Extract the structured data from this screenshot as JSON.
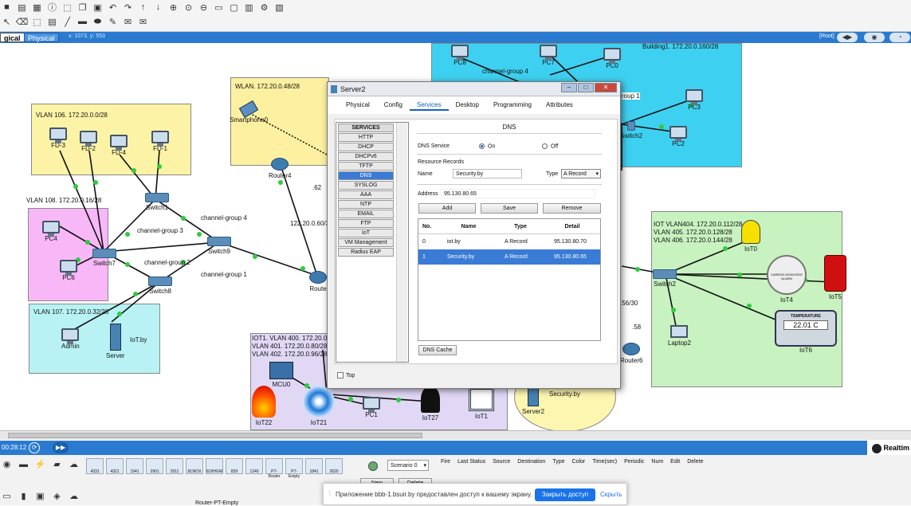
{
  "workspace_header": {
    "mode_logical": "gical",
    "mode_physical": "Physical",
    "coords": "x: 1073, y: 553",
    "root": "[Root]"
  },
  "areas": {
    "vlan106": "VLAN 106. 172.20.0.0/28",
    "vlan108": "VLAN 108. 172.20.0.16/28",
    "vlan107": "VLAN 107. 172.20.0.32/28",
    "wlan": "WLAN. 172.20.0.48/28",
    "building1": "Building1. 172.20.0.160/28",
    "iot_right": [
      "IOT VLAN404. 172.20.0.112/28",
      "VLAN 405. 172.20.0.128/28",
      "VLAN 406. 172.20.0.144/28"
    ],
    "iot_bottom": [
      "IOT1. VLAN 400. 172.20.0.64/28",
      "VLAN 401. 172.20.0.80/28",
      "VLAN 402. 172.20.0.96/28"
    ]
  },
  "devices": {
    "fd3": "FD-3",
    "fd2": "FD-2",
    "fd4": "FD-4",
    "fd1": "FD-1",
    "switch1": "Switch1",
    "switch9": "Switch9",
    "switch7": "Switch7",
    "switch8": "Switch8",
    "pc4": "PC4",
    "pc6": "PC6",
    "admin": "Admin",
    "server": "Server",
    "iotby": "IoT.by",
    "smartphone": "Smartphone0",
    "router4": "Router4",
    "router": "Route",
    "pc8": "PC8",
    "pc7": "PC7",
    "pc0": "PC0",
    "pc3": "PC3",
    "pc2": "PC2",
    "switch2": "Switch2",
    "switch2b": "Switch2",
    "iot0": "IoT0",
    "iot4": "IoT4",
    "iot5": "IoT5",
    "laptop2": "Laptop2",
    "iot6": "IoT6",
    "mcu0": "MCU0",
    "iot22": "IoT22",
    "iot21": "IoT21",
    "pc1": "PC1",
    "iot27": "IoT27",
    "iot1": "IoT1",
    "server2": "Server2",
    "security": "Security.by",
    "router6": "Router6"
  },
  "link_labels": {
    "cg4": "channel-group 4",
    "cg3": "channel-group 3",
    "cg2": "channel-group 2",
    "cg1": "channel-group 1",
    "cg4_top": "channel-group 4",
    "cg1_top": "roup 1",
    "ip62": ".62",
    "net60": "122.20.0.60/3",
    "ip5630": ".56/30",
    "ip58": ".58",
    "ip1": "1"
  },
  "iot_display": {
    "temperature_label": "TEMPERATURE",
    "temperature_value": "22.01 C",
    "alarm_text": "CARBON MONOXIDE ALARM"
  },
  "dialog": {
    "title": "Server2",
    "tabs": [
      "Physical",
      "Config",
      "Services",
      "Desktop",
      "Programming",
      "Attributes"
    ],
    "active_tab": "Services",
    "services": [
      "SERVICES",
      "HTTP",
      "DHCP",
      "DHCPv6",
      "TFTP",
      "DNS",
      "SYSLOG",
      "AAA",
      "NTP",
      "EMAIL",
      "FTP",
      "IoT",
      "VM Management",
      "Radius EAP"
    ],
    "selected_service": "DNS",
    "dns": {
      "title": "DNS",
      "service_label": "DNS Service",
      "on": "On",
      "off": "Off",
      "resource_records": "Resource Records",
      "name_label": "Name",
      "name_value": "Security.by",
      "type_label": "Type",
      "type_value": "A Record",
      "address_label": "Address",
      "address_value": "95.130.80.65",
      "add": "Add",
      "save": "Save",
      "remove": "Remove",
      "columns": [
        "No.",
        "Name",
        "Type",
        "Detail"
      ],
      "records": [
        {
          "no": "0",
          "name": "iot.by",
          "type": "A Record",
          "detail": "95.130.80.70"
        },
        {
          "no": "1",
          "name": "Security.by",
          "type": "A Record",
          "detail": "95.130.80.65"
        }
      ],
      "cache_button": "DNS Cache"
    },
    "top_checkbox": "Top"
  },
  "timebar": {
    "time": "00:28:12",
    "realtime": "Realtim"
  },
  "bottom": {
    "device_models": [
      "4331",
      "4321",
      "1941",
      "2901",
      "2911",
      "819IOX",
      "819HGW",
      "829",
      "1240",
      "PT-Router",
      "PT-Empty",
      "1841",
      "2620"
    ],
    "scenario": "Scenario 0",
    "new_button": "New",
    "delete_button": "Delete",
    "pdu_columns": [
      "Fire",
      "Last Status",
      "Source",
      "Destination",
      "Type",
      "Color",
      "Time(sec)",
      "Periodic",
      "Num",
      "Edit",
      "Delete"
    ],
    "selected_model": "Router-PT-Empty"
  },
  "notice": {
    "text": "Приложение bbb-1.bsuir.by предоставлен доступ к вашему экрану.",
    "share_button": "Закрыть доступ",
    "hide_link": "Скрыть"
  },
  "colors": {
    "vlan106": "#fdf3a6",
    "vlan108": "#f8b8f8",
    "vlan107": "#b8f2f4",
    "wlan": "#fdf0a0",
    "building": "#3ed0f0",
    "iot_right": "#c8f2c0",
    "iot_bottom": "#e0d8f4",
    "accent": "#2a7ad0"
  }
}
